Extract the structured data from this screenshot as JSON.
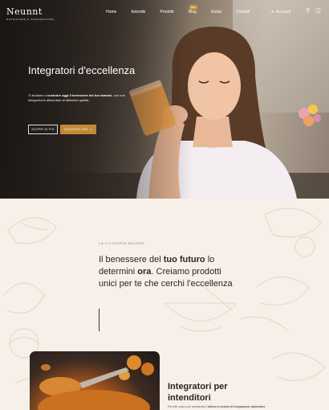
{
  "brand": {
    "name": "Neunnt",
    "tagline": "NUTRIZIONE E INTEGRAZIONE"
  },
  "nav": {
    "items": [
      {
        "label": "Home"
      },
      {
        "label": "Aziende"
      },
      {
        "label": "Prodotti"
      },
      {
        "label": "Blog",
        "badge": "New"
      },
      {
        "label": "Guida"
      },
      {
        "label": "Contatti"
      }
    ],
    "account_label": "Account",
    "icons": [
      "user-icon",
      "search-icon",
      "cart-icon"
    ]
  },
  "hero": {
    "title": "Integratori d'eccellenza",
    "text_pre": "Ti aiutiamo a ",
    "text_bold1": "costruire oggi il benessere del tuo domani",
    "text_post": ", con una integrazione alimentare di altissima qualità.",
    "btn_secondary": "SCOPRI DI PIÙ",
    "btn_primary": "ACQUISTA ORA",
    "btn_primary_icon": "arrow-right-icon"
  },
  "intro": {
    "eyebrow": "LA FILOSOFIA NEURNT",
    "lead_1": "Il benessere del ",
    "lead_bold_1": "tuo futuro",
    "lead_2": " lo determini ",
    "lead_bold_2": "ora",
    "lead_3": ". Creiamo prodotti unici per te che cerchi l'eccellenza"
  },
  "feature": {
    "title": "Integratori per intenditori",
    "text_pre": "Per tutti coloro che desiderano l'",
    "text_bold": "ottimo in termini di integrazione alimentare"
  },
  "colors": {
    "accent": "#c08a35",
    "background": "#f6f0e8",
    "hero_dark": "#2b2622"
  }
}
